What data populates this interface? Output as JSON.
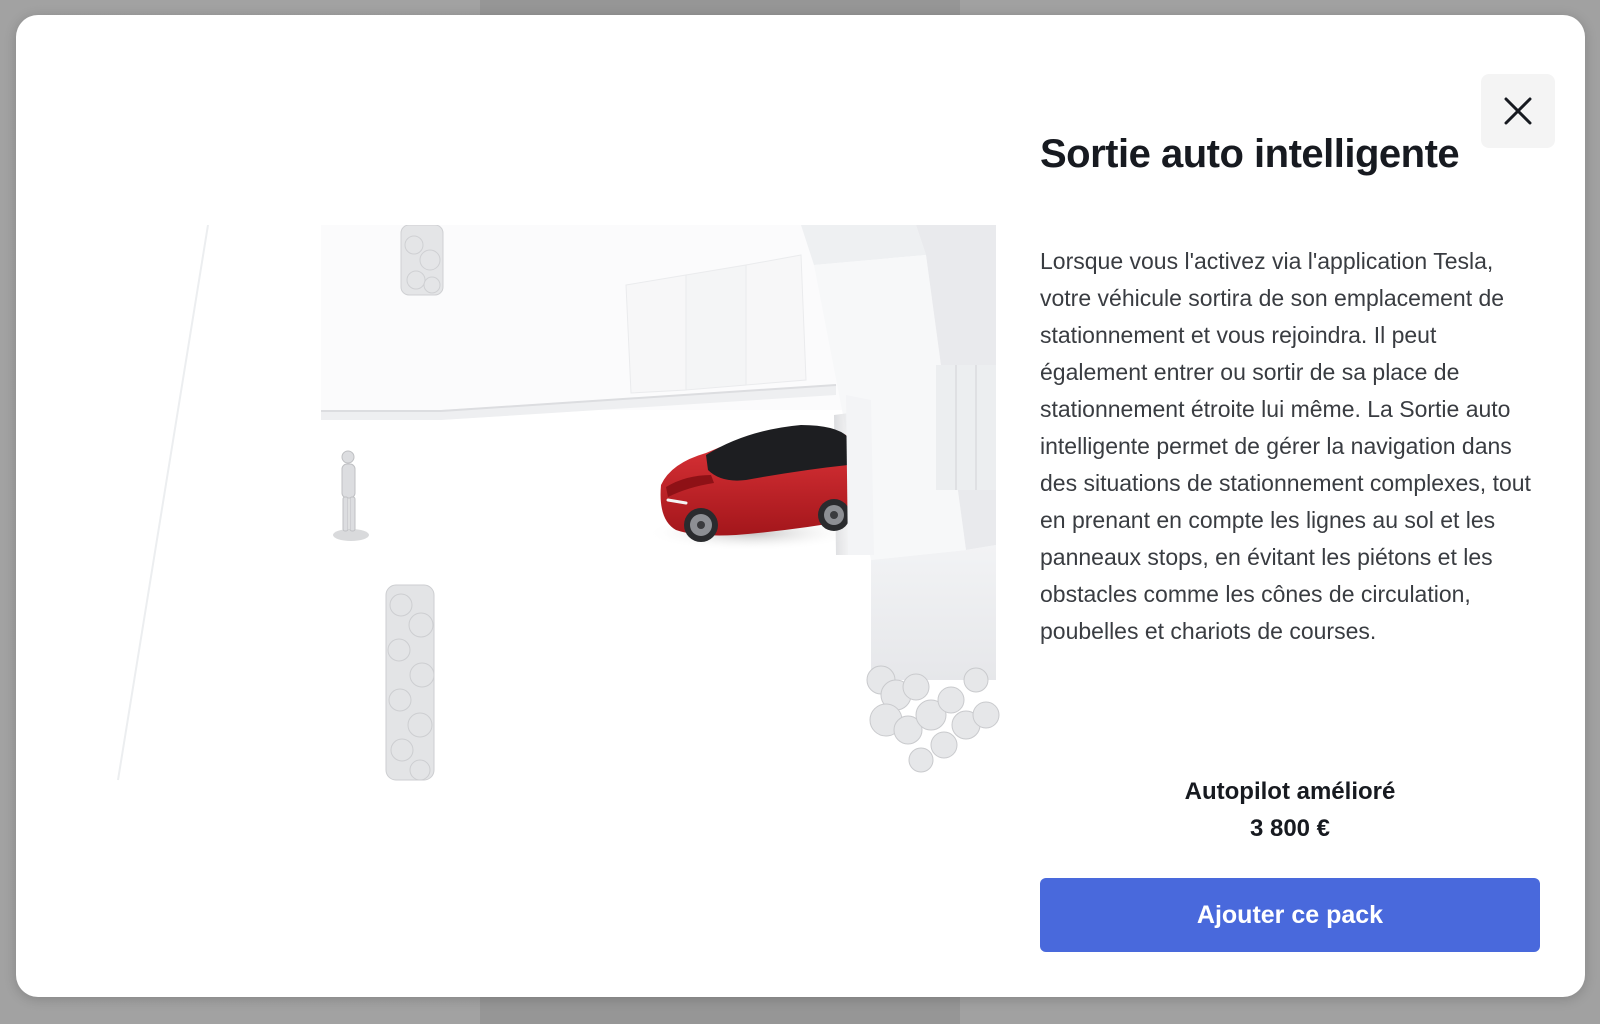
{
  "modal": {
    "title": "Sortie auto intelligente",
    "description": "Lorsque vous l'activez via l'application Tesla, votre véhicule sortira de son emplacement de stationnement et vous rejoindra. Il peut également entrer ou sortir de sa place de stationnement étroite lui même. La Sortie auto intelligente permet de gérer la navigation dans des situations de stationnement complexes, tout en prenant en compte les lignes au sol et les panneaux stops, en évitant les piétons et les obstacles comme les cônes de circulation, poubelles et chariots de courses.",
    "package_name": "Autopilot amélioré",
    "package_price": "3 800 €",
    "add_button_label": "Ajouter ce pack",
    "close_icon": "close-icon",
    "illustration": "parking-lot-illustration"
  },
  "colors": {
    "accent": "#4969dc",
    "title_text": "#171a20",
    "body_text": "#393c41",
    "car": "#c81e22"
  }
}
